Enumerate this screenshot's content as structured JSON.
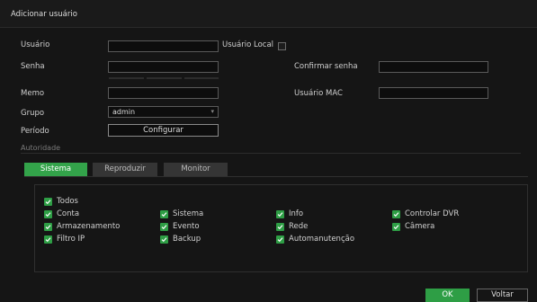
{
  "window": {
    "title": "Adicionar usuário"
  },
  "form": {
    "usuario_label": "Usuário",
    "usuario_value": "",
    "usuario_local_label": "Usuário Local",
    "senha_label": "Senha",
    "senha_value": "",
    "confirmar_label": "Confirmar senha",
    "confirmar_value": "",
    "memo_label": "Memo",
    "memo_value": "",
    "mac_label": "Usuário MAC",
    "mac_value": "",
    "grupo_label": "Grupo",
    "grupo_value": "admin",
    "periodo_label": "Período",
    "configurar_label": "Configurar"
  },
  "autoridade": {
    "section_label": "Autoridade",
    "tabs": [
      {
        "label": "Sistema",
        "active": true
      },
      {
        "label": "Reproduzir",
        "active": false
      },
      {
        "label": "Monitor",
        "active": false
      }
    ],
    "permissions": [
      {
        "label": "Todos",
        "checked": true
      },
      {
        "label": "Conta",
        "checked": true
      },
      {
        "label": "Sistema",
        "checked": true
      },
      {
        "label": "Info",
        "checked": true
      },
      {
        "label": "Controlar DVR",
        "checked": true
      },
      {
        "label": "Armazenamento",
        "checked": true
      },
      {
        "label": "Evento",
        "checked": true
      },
      {
        "label": "Rede",
        "checked": true
      },
      {
        "label": "Câmera",
        "checked": true
      },
      {
        "label": "Filtro IP",
        "checked": true
      },
      {
        "label": "Backup",
        "checked": true
      },
      {
        "label": "Automanutenção",
        "checked": true
      }
    ]
  },
  "footer": {
    "ok_label": "OK",
    "voltar_label": "Voltar"
  },
  "colors": {
    "accent": "#2e9e45",
    "background": "#151515"
  }
}
